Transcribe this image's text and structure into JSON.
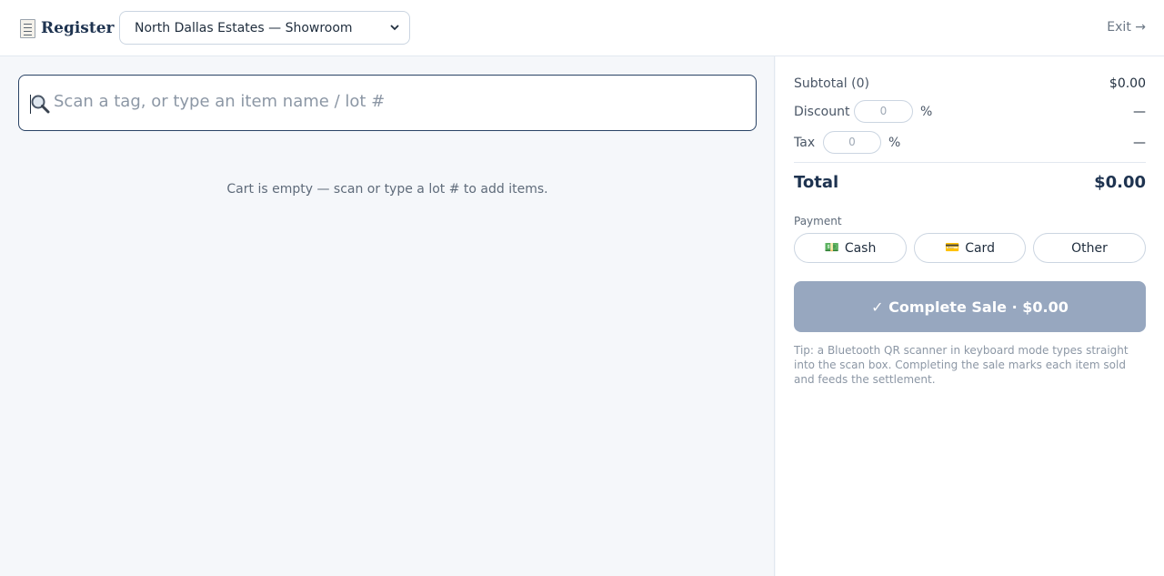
{
  "header": {
    "brand_icon": "receipt-icon",
    "brand_title": "Register",
    "location": "North Dallas Estates — Showroom",
    "exit_label": "Exit →"
  },
  "scan": {
    "icon": "magnifier-icon",
    "placeholder": "Scan a tag, or type an item name / lot #"
  },
  "cart": {
    "empty_message": "Cart is empty — scan or type a lot # to add items."
  },
  "summary": {
    "subtotal_label": "Subtotal (0)",
    "subtotal_value": "$0.00",
    "discount_label": "Discount",
    "discount_input": "0",
    "discount_unit": "%",
    "discount_value": "—",
    "tax_label": "Tax",
    "tax_input": "0",
    "tax_unit": "%",
    "tax_value": "—",
    "total_label": "Total",
    "total_value": "$0.00"
  },
  "payment": {
    "label": "Payment",
    "methods": [
      {
        "icon": "💵",
        "label": "Cash"
      },
      {
        "icon": "💳",
        "label": "Card"
      },
      {
        "icon": "",
        "label": "Other"
      }
    ]
  },
  "complete_label": "✓ Complete Sale · $0.00",
  "tip": "Tip: a Bluetooth QR scanner in keyboard mode types straight into the scan box. Completing the sale marks each item sold and feeds the settlement.",
  "colors": {
    "accent": "#1e3350",
    "complete_disabled": "#97a7bf",
    "scan_border": "#2a4365"
  }
}
